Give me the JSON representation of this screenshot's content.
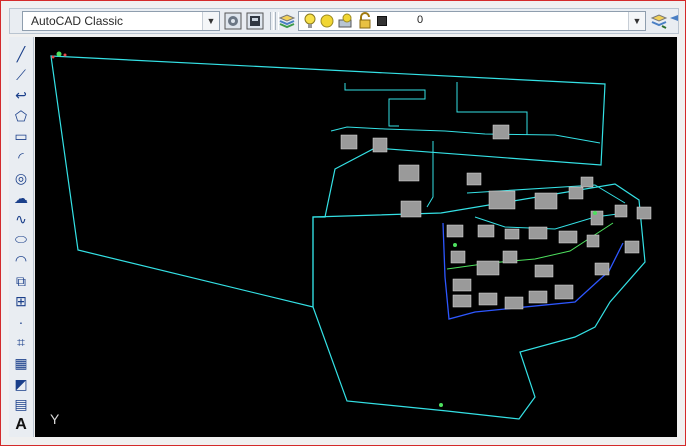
{
  "toolbar": {
    "workspace_value": "AutoCAD Classic",
    "layer_value": "0"
  },
  "icons": {
    "workspace_settings": "workspace-settings-icon",
    "customize": "customize-icon",
    "layer_manager": "layer-manager-icon",
    "bulb": "lightbulb-icon",
    "sun": "sun-freeze-icon",
    "lock": "lock-icon",
    "color_square": "color-square-icon"
  },
  "left_toolbar": {
    "tools": [
      {
        "name": "line",
        "glyph": "╱"
      },
      {
        "name": "construction-line",
        "glyph": "⟋"
      },
      {
        "name": "polyline",
        "glyph": "↩"
      },
      {
        "name": "polygon",
        "glyph": "⬠"
      },
      {
        "name": "rectangle",
        "glyph": "▭"
      },
      {
        "name": "arc",
        "glyph": "◜"
      },
      {
        "name": "circle",
        "glyph": "◎"
      },
      {
        "name": "revision-cloud",
        "glyph": "☁"
      },
      {
        "name": "spline",
        "glyph": "∿"
      },
      {
        "name": "ellipse",
        "glyph": "⬭"
      },
      {
        "name": "ellipse-arc",
        "glyph": "◠"
      },
      {
        "name": "insert-block",
        "glyph": "⧉"
      },
      {
        "name": "make-block",
        "glyph": "⊞"
      },
      {
        "name": "point",
        "glyph": "·"
      },
      {
        "name": "hatch",
        "glyph": "⌗"
      },
      {
        "name": "gradient",
        "glyph": "▦"
      },
      {
        "name": "region",
        "glyph": "◩"
      },
      {
        "name": "table",
        "glyph": "▤"
      },
      {
        "name": "multiline-text",
        "glyph": "A"
      }
    ]
  },
  "canvas": {
    "ucs_label": "Y",
    "background": "#000000",
    "line_color": "#34e1e5",
    "accent_blue": "#2d57ff",
    "accent_green": "#4de05e",
    "block_gray": "#9a9a9a"
  },
  "frame": {
    "border_color": "#d42a2a"
  }
}
